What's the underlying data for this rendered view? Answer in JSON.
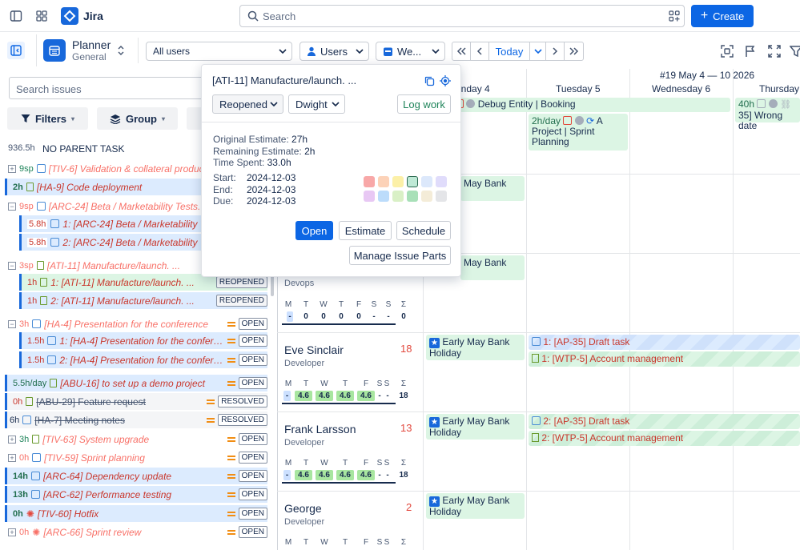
{
  "app": {
    "name": "Jira"
  },
  "search": {
    "placeholder": "Search"
  },
  "header": {
    "create_label": "Create"
  },
  "planner": {
    "title": "Planner",
    "subtitle": "General"
  },
  "toolbar": {
    "users_filter": "All users",
    "group_by": "Users",
    "view": "We...",
    "today_label": "Today"
  },
  "left": {
    "search_placeholder": "Search issues",
    "filters_label": "Filters",
    "group_label": "Group",
    "no_parent": {
      "estimate": "936.5h",
      "label": "NO PARENT TASK"
    }
  },
  "issues": [
    {
      "est": "9sp",
      "title": "[TIV-6] Validation & collateral produc...",
      "status": ""
    },
    {
      "est": "2h",
      "title": "[HA-9] Code deployment",
      "status": ""
    },
    {
      "est": "9sp",
      "title": "[ARC-24] Beta / Marketability Tests.",
      "status": ""
    },
    {
      "est": "5.8h",
      "title": "1: [ARC-24] Beta / Marketability Te...",
      "status": ""
    },
    {
      "est": "5.8h",
      "title": "2: [ARC-24] Beta / Marketability Te...",
      "status": ""
    },
    {
      "est": "3sp",
      "title": "[ATI-11] Manufacture/launch. ...",
      "status": ""
    },
    {
      "est": "1h",
      "title": "1: [ATI-11] Manufacture/launch. ...",
      "status": "REOPENED"
    },
    {
      "est": "1h",
      "title": "2: [ATI-11] Manufacture/launch. ...",
      "status": "REOPENED"
    },
    {
      "est": "3h",
      "title": "[HA-4] Presentation for the conference",
      "status": "OPEN"
    },
    {
      "est": "1.5h",
      "title": "1: [HA-4] Presentation for the conference",
      "status": "OPEN"
    },
    {
      "est": "1.5h",
      "title": "2: [HA-4] Presentation for the conference",
      "status": "OPEN"
    },
    {
      "est": "5.5h/day",
      "title": "[ABU-16] to set up a demo project",
      "status": "OPEN"
    },
    {
      "est": "0h",
      "title": "[ABU-29] Feature request",
      "status": "RESOLVED"
    },
    {
      "est": "6h",
      "title": "[HA-7] Meeting notes",
      "status": "RESOLVED"
    },
    {
      "est": "3h",
      "title": "[TIV-63] System upgrade",
      "status": "OPEN"
    },
    {
      "est": "0h",
      "title": "[TIV-59] Sprint planning",
      "status": "OPEN"
    },
    {
      "est": "14h",
      "title": "[ARC-64] Dependency update",
      "status": "OPEN"
    },
    {
      "est": "13h",
      "title": "[ARC-62] Performance testing",
      "status": "OPEN"
    },
    {
      "est": "0h",
      "title": "[TIV-60] Hotfix",
      "status": "OPEN"
    },
    {
      "est": "0h",
      "title": "[ARC-66] Sprint review",
      "status": "OPEN"
    }
  ],
  "calendar": {
    "week_label": "#19 May 4 — 10 2026",
    "days": [
      "onday 4",
      "Tuesday 5",
      "Wednesday 6",
      "Thursday"
    ]
  },
  "popup": {
    "title": "[ATI-11] Manufacture/launch. ...",
    "status": "Reopened",
    "assignee": "Dwight",
    "log_work": "Log work",
    "original_estimate_label": "Original Estimate:",
    "original_estimate": "27h",
    "remaining_estimate_label": "Remaining Estimate:",
    "remaining_estimate": "2h",
    "time_spent_label": "Time Spent:",
    "time_spent": "33.0h",
    "start_label": "Start:",
    "start": "2024-12-03",
    "end_label": "End:",
    "end": "2024-12-03",
    "due_label": "Due:",
    "due": "2024-12-03",
    "open_btn": "Open",
    "estimate_btn": "Estimate",
    "schedule_btn": "Schedule",
    "manage_btn": "Manage Issue Parts",
    "colors": [
      "#f8a8a8",
      "#fcd2b8",
      "#fcf0a8",
      "#bfe9d6",
      "#dce8fb",
      "#e0dcfb",
      "#e8c8f4",
      "#bcdcfb",
      "#d9f0c6",
      "#a8e0b8",
      "#f4ecd8",
      "#e4e5e8"
    ]
  },
  "people": [
    {
      "name": "Eve Sinclair",
      "role": "Developer",
      "count": "18",
      "days": [
        "M",
        "T",
        "W",
        "T",
        "F",
        "S",
        "S",
        "Σ"
      ],
      "values": [
        "-",
        "4.6",
        "4.6",
        "4.6",
        "4.6",
        "-",
        "-",
        "18"
      ]
    },
    {
      "name": "Frank Larsson",
      "role": "Developer",
      "count": "13",
      "days": [
        "M",
        "T",
        "W",
        "T",
        "F",
        "S",
        "S",
        "Σ"
      ],
      "values": [
        "-",
        "4.6",
        "4.6",
        "4.6",
        "4.6",
        "-",
        "-",
        "18"
      ]
    },
    {
      "name": "George",
      "role": "Developer",
      "count": "2",
      "days": [
        "M",
        "T",
        "W",
        "T",
        "F",
        "S",
        "S",
        "Σ"
      ]
    }
  ],
  "devops": {
    "role": "Devops",
    "days": [
      "M",
      "T",
      "W",
      "T",
      "F",
      "S",
      "S",
      "Σ"
    ],
    "values": [
      "-",
      "0",
      "0",
      "0",
      "0",
      "-",
      "-",
      "0"
    ]
  },
  "events": {
    "debug": "Debug Entity | Booking",
    "forty": "40h",
    "wrong_date": "35] Wrong date",
    "sprint_rate": "2h/day",
    "sprint_a": "A",
    "sprint_text": "Project | Sprint Planning",
    "may_bank": "May Bank",
    "holiday": "Early May Bank Holiday",
    "eve_task1": "1: [AP-35] Draft task",
    "eve_task2": "1: [WTP-5] Account management",
    "frank_task1": "2: [AP-35] Draft task",
    "frank_task2": "2: [WTP-5] Account management"
  }
}
